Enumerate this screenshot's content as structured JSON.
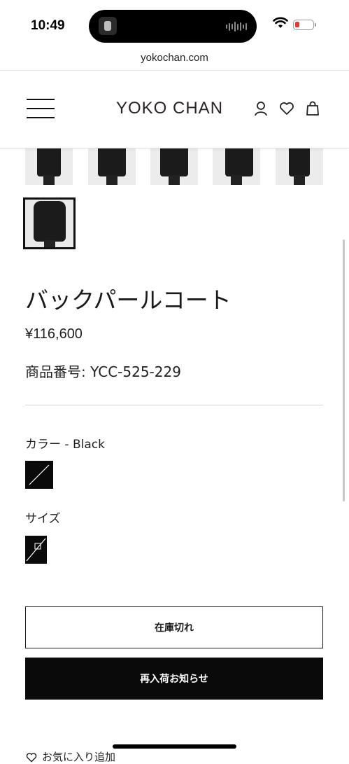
{
  "status_bar": {
    "time": "10:49"
  },
  "browser": {
    "url": "yokochan.com"
  },
  "header": {
    "logo": "YOKO CHAN"
  },
  "product": {
    "title": "バックパールコート",
    "price": "¥116,600",
    "sku_label": "商品番号:",
    "sku_value": "YCC-525-229",
    "color_label": "カラー - Black",
    "size_label": "サイズ",
    "sold_out_label": "在庫切れ",
    "notify_label": "再入荷お知らせ",
    "favorite_label": "お気に入り追加"
  },
  "colors": {
    "text": "#1a1a1a",
    "button_dark": "#0a0a0a",
    "divider": "#d8d8d8"
  }
}
